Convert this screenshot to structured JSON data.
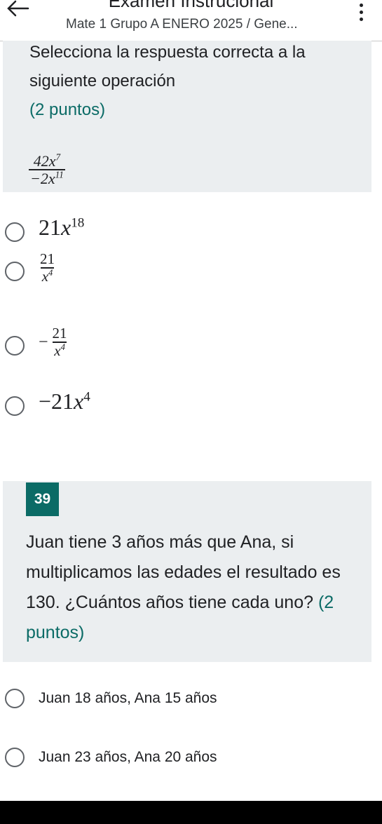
{
  "header": {
    "title": "Examen Instrucional",
    "subtitle": "Mate 1 Grupo A ENERO 2025 / Gene..."
  },
  "question1": {
    "text": "Selecciona la respuesta correcta a la siguiente operación",
    "points": "(2 puntos)",
    "expression": {
      "numerator": "42x7",
      "denominator": "-2x11"
    },
    "options": [
      {
        "label": "21x^18",
        "coef": "21",
        "var": "x",
        "exp": "18"
      },
      {
        "label": "21/x^4",
        "num": "21",
        "var": "x",
        "exp": "4"
      },
      {
        "label": "-21/x^4",
        "sign": "−",
        "num": "21",
        "var": "x",
        "exp": "4"
      },
      {
        "label": "-21x^4",
        "coef": "−21",
        "var": "x",
        "exp": "4"
      }
    ]
  },
  "question2": {
    "number": "39",
    "text": "Juan tiene 3 años más que Ana, si multiplicamos las edades el resultado es 130. ¿Cuántos años tiene cada uno?",
    "points": "(2 puntos)",
    "options": [
      {
        "label": "Juan 18 años, Ana 15 años"
      },
      {
        "label": "Juan 23 años, Ana 20 años"
      }
    ]
  },
  "colors": {
    "accent": "#0b6b66",
    "card_bg": "#ebeef0"
  },
  "icons": {
    "back": "arrow-left-icon",
    "menu": "more-vertical-icon"
  }
}
